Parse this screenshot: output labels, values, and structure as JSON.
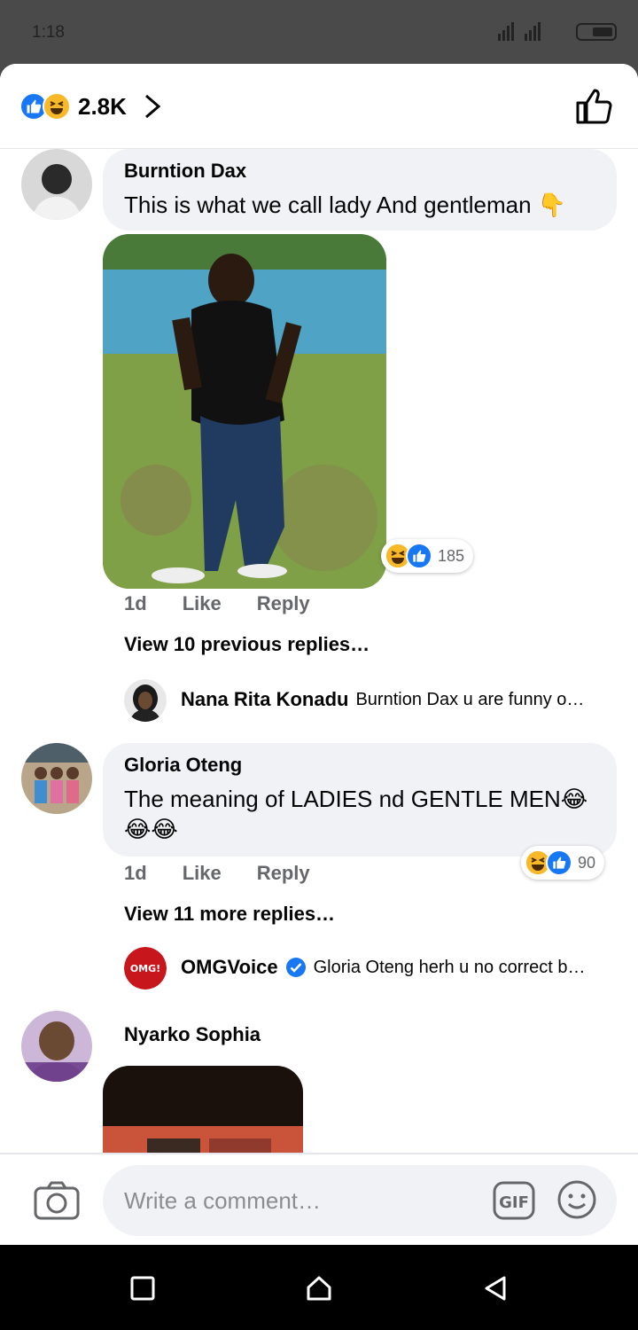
{
  "status_bar": {
    "time": "1:18"
  },
  "header": {
    "reaction_count": "2.8K"
  },
  "comments": [
    {
      "name": "Burntion  Dax",
      "text": "This is what we call lady And gentleman 👇",
      "reaction_count": "185",
      "time": "1d",
      "like": "Like",
      "reply": "Reply",
      "view_replies": "View 10 previous replies…",
      "latest_reply": {
        "name": "Nana Rita Konadu",
        "text": "Burntion  Dax u are funny o…"
      }
    },
    {
      "name": "Gloria Oteng",
      "text": " The meaning of LADIES nd GENTLE MEN😂😂😂",
      "reaction_count": "90",
      "time": "1d",
      "like": "Like",
      "reply": "Reply",
      "view_replies": "View 11 more replies…",
      "latest_reply": {
        "name": "OMGVoice",
        "text": "Gloria Oteng herh u no correct b…"
      }
    },
    {
      "name": "Nyarko Sophia"
    }
  ],
  "composer": {
    "placeholder": "Write a comment…"
  },
  "colors": {
    "facebook_blue": "#1877f2",
    "haha_yellow": "#f7b928",
    "bubble_gray": "#f0f2f5",
    "meta_gray": "#65676b"
  }
}
